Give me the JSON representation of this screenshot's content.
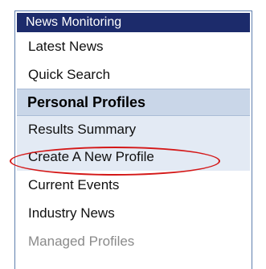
{
  "menu": {
    "title": "News Monitoring",
    "top_items": [
      {
        "label": "Latest News"
      },
      {
        "label": "Quick Search"
      }
    ],
    "section": {
      "title": "Personal Profiles",
      "items": [
        {
          "label": "Results Summary"
        },
        {
          "label": "Create A New Profile"
        }
      ]
    },
    "bottom_items": [
      {
        "label": "Current Events"
      },
      {
        "label": "Industry News"
      },
      {
        "label": "Managed Profiles",
        "disabled": true
      }
    ]
  },
  "colors": {
    "header_bg": "#1c2b6b",
    "section_bg": "#c9d6e8",
    "highlight_circle": "#d41818",
    "disabled_text": "#8a8a8a"
  }
}
